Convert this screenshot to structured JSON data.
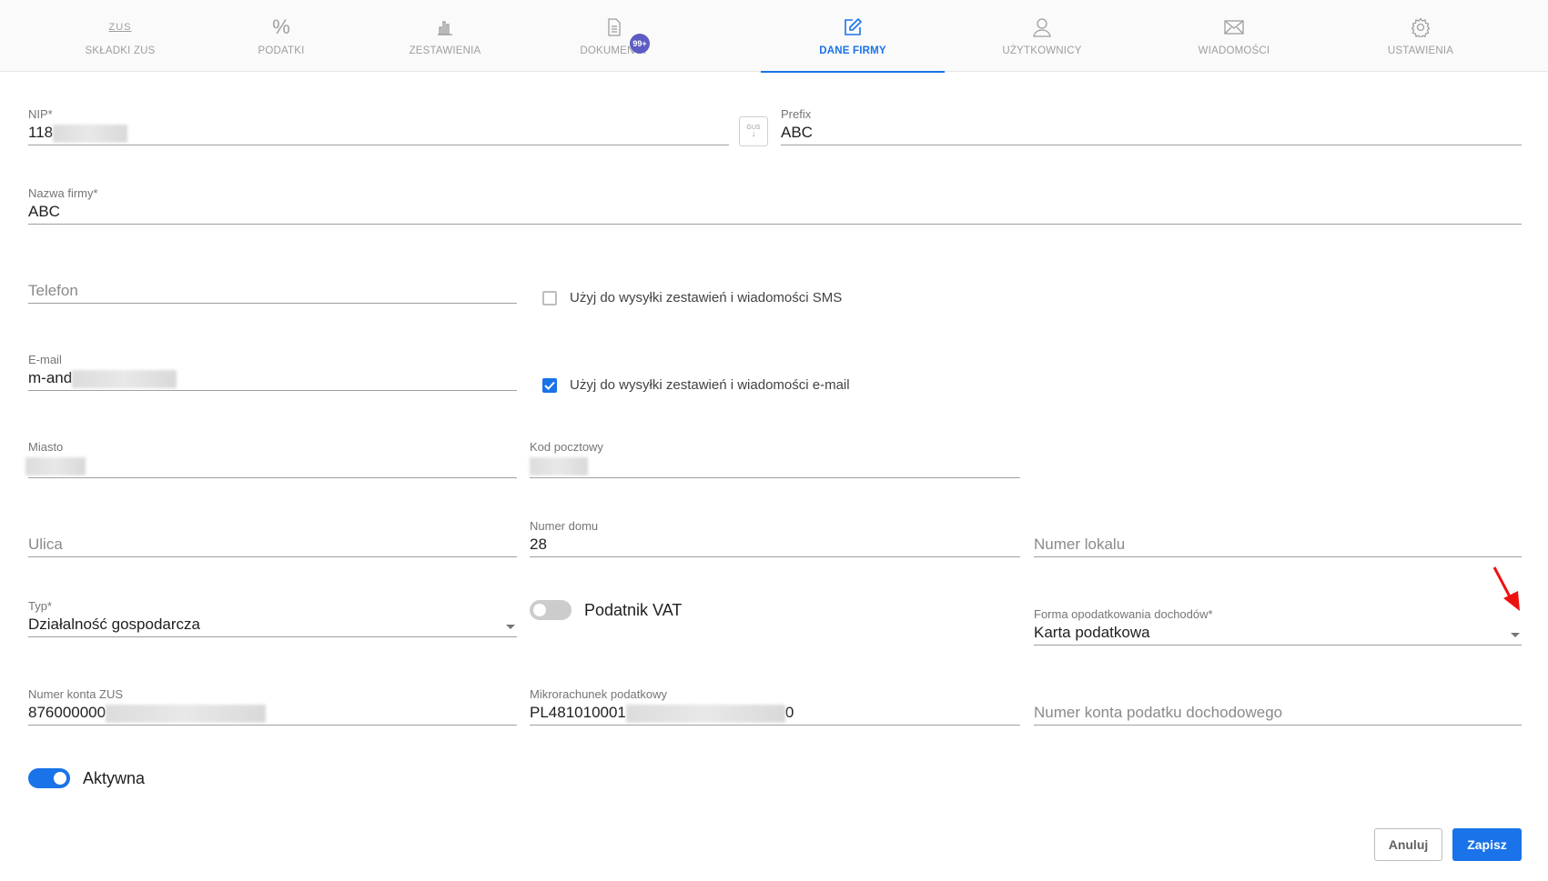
{
  "nav": {
    "tabs": [
      {
        "label": "SKŁADKI ZUS",
        "icon": "zus-icon"
      },
      {
        "label": "PODATKI",
        "icon": "percent-icon"
      },
      {
        "label": "ZESTAWIENIA",
        "icon": "bar-chart-icon"
      },
      {
        "label": "DOKUMENTY",
        "icon": "document-icon",
        "badge": "99+"
      },
      {
        "label": "DANE FIRMY",
        "icon": "edit-icon",
        "active": true
      },
      {
        "label": "UŻYTKOWNICY",
        "icon": "user-icon"
      },
      {
        "label": "WIADOMOŚCI",
        "icon": "mail-icon"
      },
      {
        "label": "USTAWIENIA",
        "icon": "gear-icon"
      }
    ],
    "zus_icon_text": "ZUS",
    "colors": {
      "active": "#1a73e8",
      "inactive": "#9e9e9e",
      "badge": "#5c5cc4"
    }
  },
  "form": {
    "nip": {
      "label": "NIP*",
      "value": "118"
    },
    "gus_button": {
      "label": "GUS"
    },
    "prefix": {
      "label": "Prefix",
      "value": "ABC"
    },
    "company_name": {
      "label": "Nazwa firmy*",
      "value": "ABC"
    },
    "phone": {
      "placeholder": "Telefon"
    },
    "sms_checkbox": {
      "label": "Użyj do wysyłki zestawień i wiadomości SMS",
      "checked": false
    },
    "email": {
      "label": "E-mail",
      "value": "m-and"
    },
    "email_checkbox": {
      "label": "Użyj do wysyłki zestawień i wiadomości e-mail",
      "checked": true
    },
    "city": {
      "label": "Miasto",
      "value": ""
    },
    "postal_code": {
      "label": "Kod pocztowy",
      "value": ""
    },
    "street": {
      "placeholder": "Ulica"
    },
    "house_number": {
      "label": "Numer domu",
      "value": "28"
    },
    "apartment_number": {
      "placeholder": "Numer lokalu"
    },
    "type": {
      "label": "Typ*",
      "value": "Działalność gospodarcza"
    },
    "vat_toggle": {
      "label": "Podatnik VAT",
      "on": false
    },
    "tax_form": {
      "label": "Forma opodatkowania dochodów*",
      "value": "Karta podatkowa"
    },
    "zus_account": {
      "label": "Numer konta ZUS",
      "value": "876000000"
    },
    "micro_account": {
      "label": "Mikrorachunek podatkowy",
      "value": "PL481010001",
      "value_tail": "0"
    },
    "income_tax_account": {
      "placeholder": "Numer konta podatku dochodowego"
    },
    "active_toggle": {
      "label": "Aktywna",
      "on": true
    }
  },
  "actions": {
    "cancel_label": "Anuluj",
    "save_label": "Zapisz"
  }
}
